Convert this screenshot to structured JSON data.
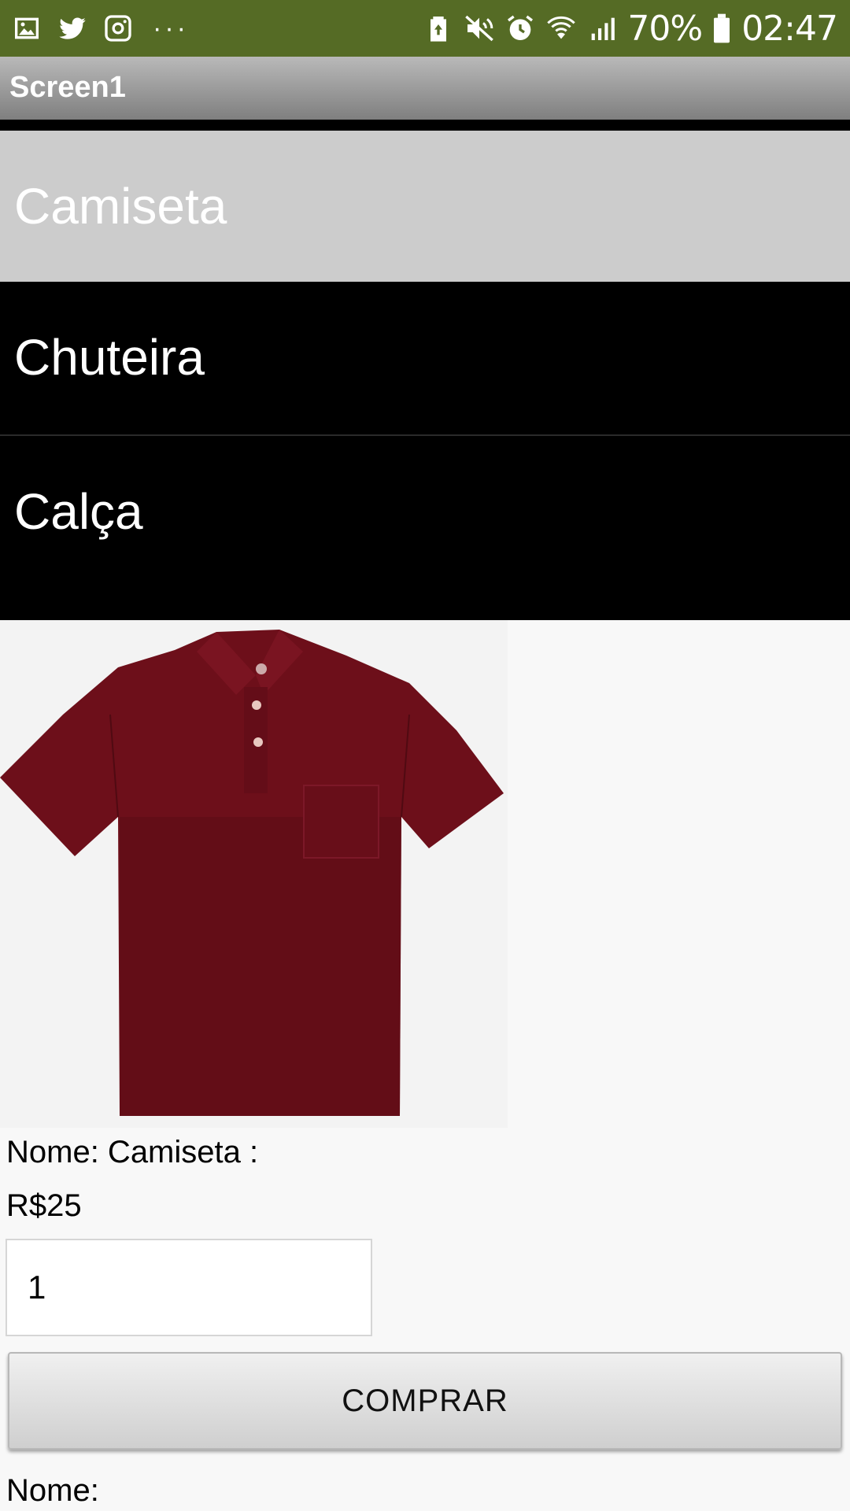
{
  "status_bar": {
    "left_icons": [
      "image-icon",
      "twitter-icon",
      "instagram-icon"
    ],
    "more": "···",
    "battery_percent": "70%",
    "time": "02:47",
    "color": "#556b25"
  },
  "titlebar": {
    "title": "Screen1"
  },
  "list": {
    "items": [
      {
        "label": "Camiseta",
        "selected": true
      },
      {
        "label": "Chuteira",
        "selected": false
      },
      {
        "label": "Calça",
        "selected": false
      }
    ]
  },
  "product": {
    "image": "maroon-polo-shirt",
    "name_label": "Nome: Camiseta :",
    "price_label": "R$25",
    "quantity_value": "1"
  },
  "buy_button": {
    "label": "COMPRAR"
  },
  "footer": {
    "name_label": "Nome:"
  }
}
